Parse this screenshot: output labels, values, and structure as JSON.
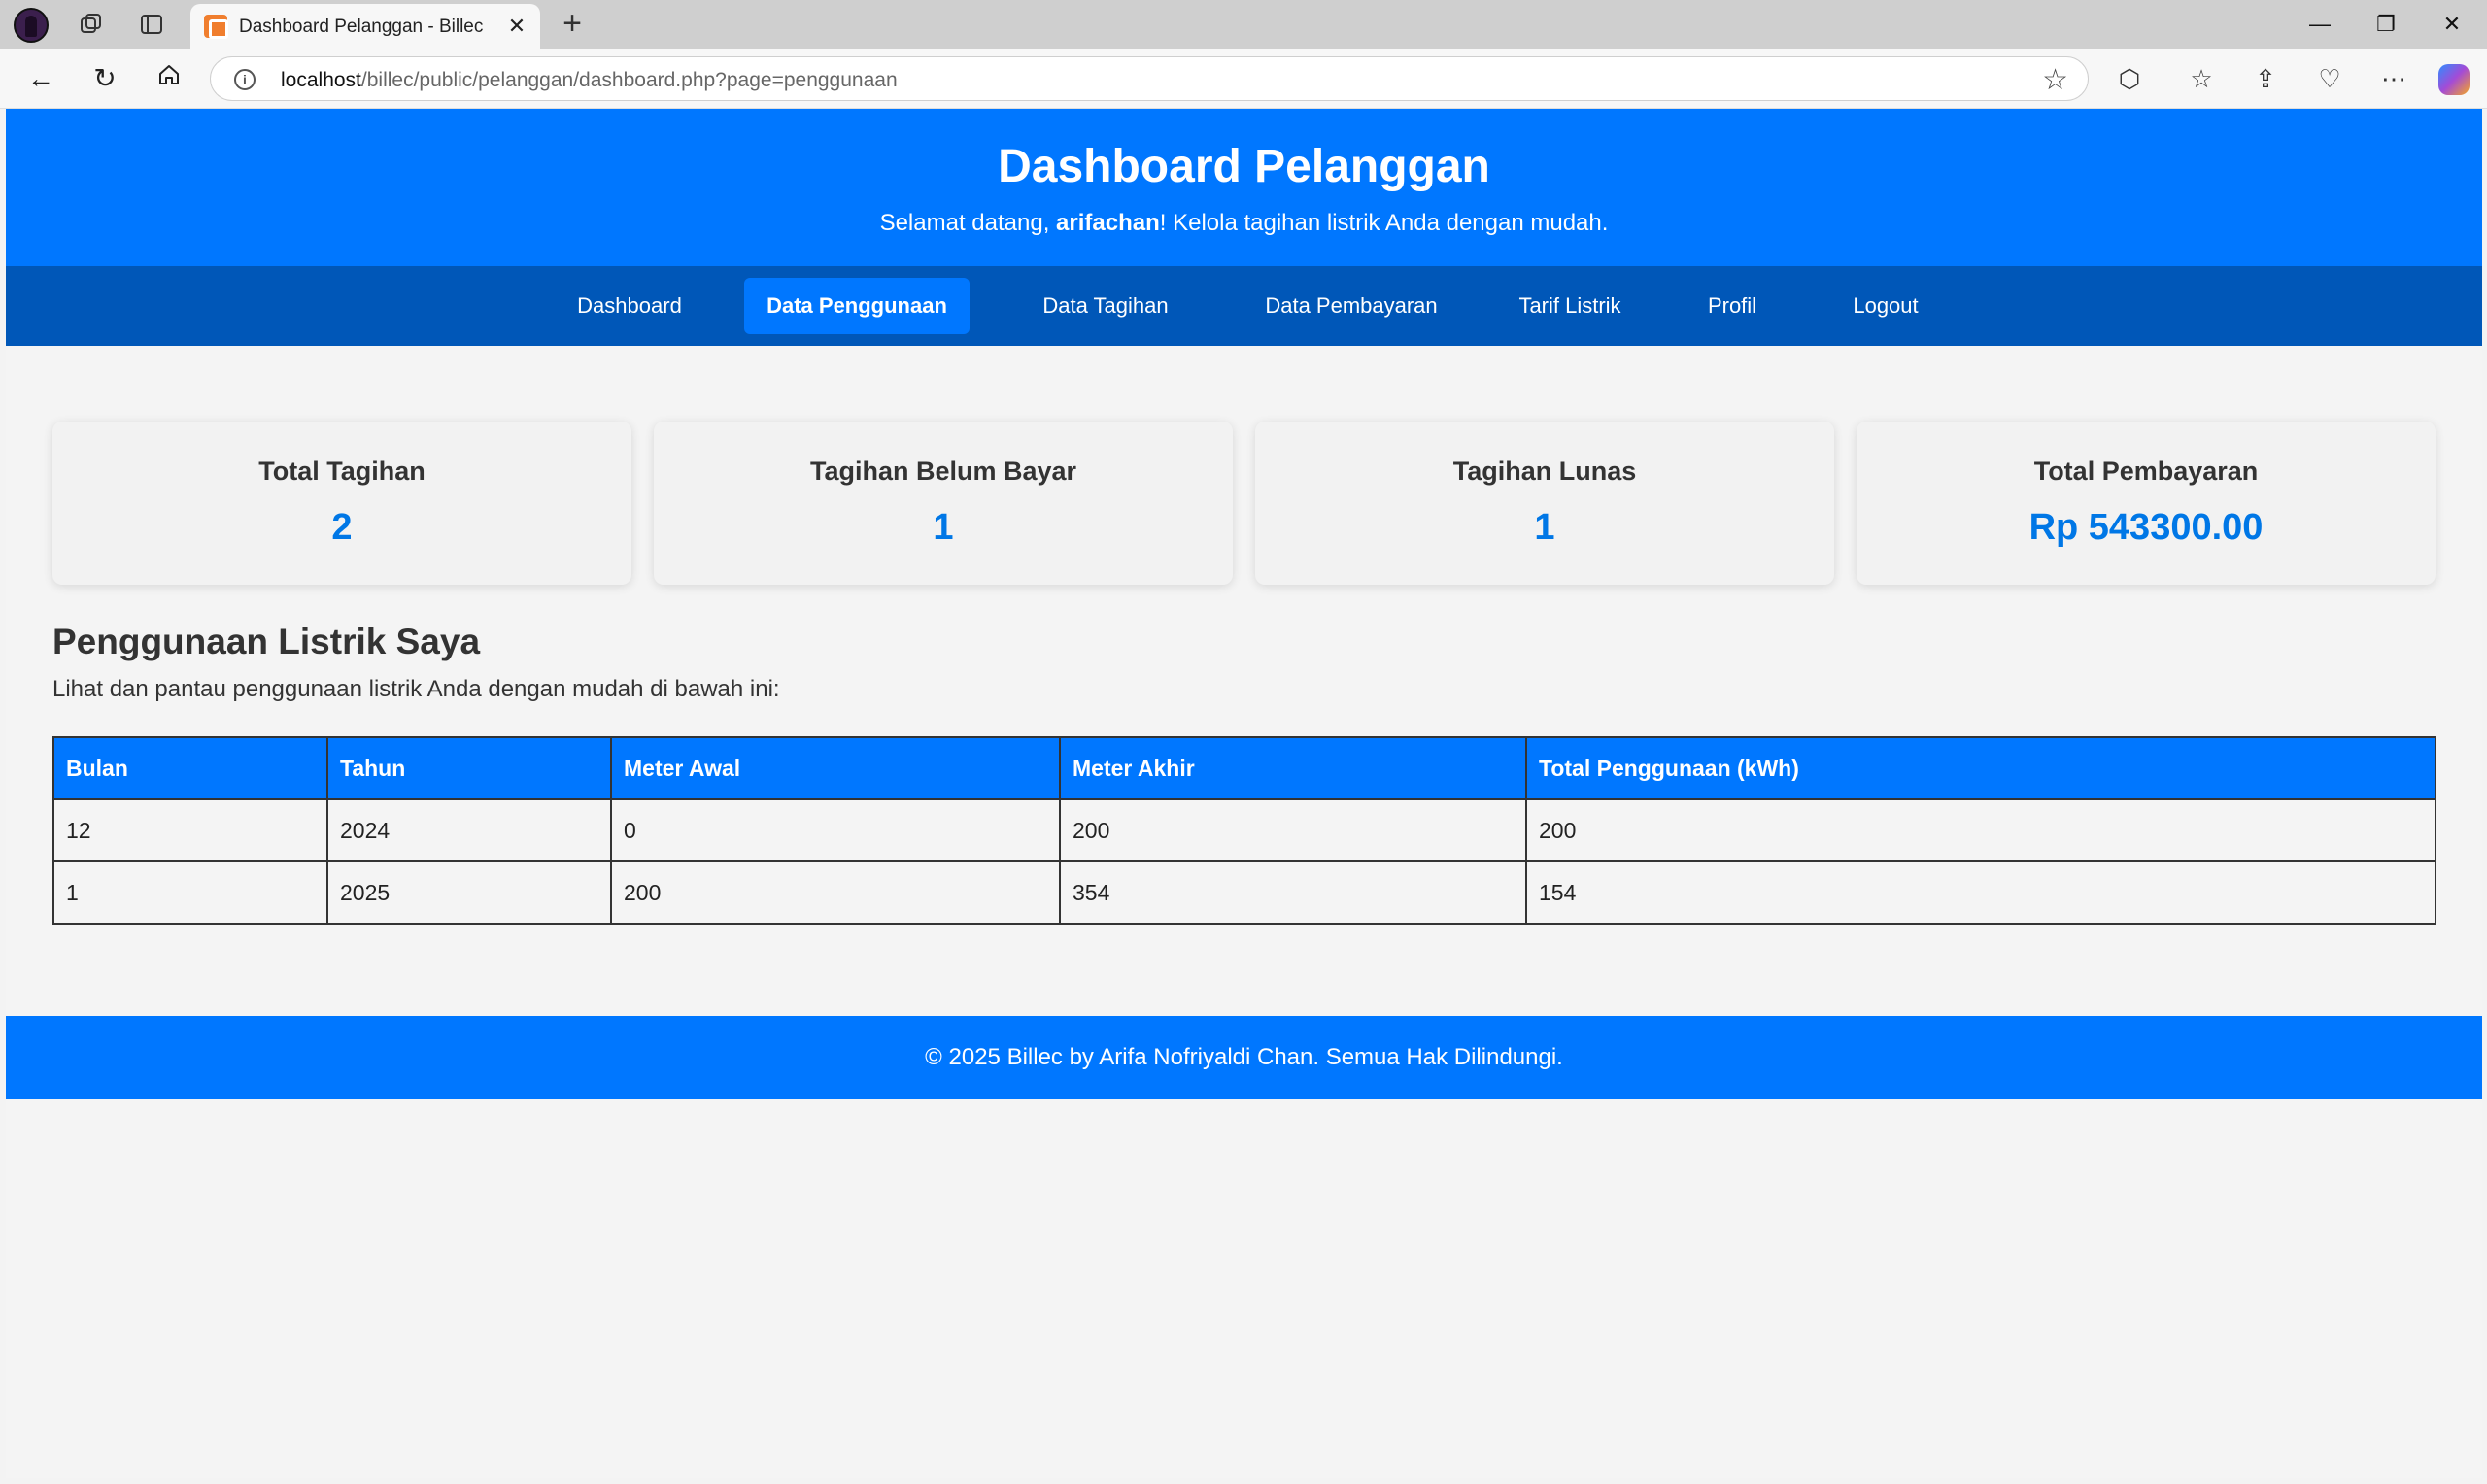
{
  "browser": {
    "tab_title": "Dashboard Pelanggan - Billec",
    "url_host": "localhost",
    "url_path": "/billec/public/pelanggan/dashboard.php?page=penggunaan"
  },
  "header": {
    "title": "Dashboard Pelanggan",
    "welcome_prefix": "Selamat datang, ",
    "username": "arifachan",
    "welcome_suffix": "! Kelola tagihan listrik Anda dengan mudah."
  },
  "nav": {
    "items": [
      {
        "label": "Dashboard"
      },
      {
        "label": "Data Penggunaan"
      },
      {
        "label": "Data Tagihan"
      },
      {
        "label": "Data Pembayaran"
      },
      {
        "label": "Tarif Listrik"
      },
      {
        "label": "Profil"
      },
      {
        "label": "Logout"
      }
    ]
  },
  "stats": [
    {
      "title": "Total Tagihan",
      "value": "2"
    },
    {
      "title": "Tagihan Belum Bayar",
      "value": "1"
    },
    {
      "title": "Tagihan Lunas",
      "value": "1"
    },
    {
      "title": "Total Pembayaran",
      "value": "Rp 543300.00"
    }
  ],
  "usage": {
    "title": "Penggunaan Listrik Saya",
    "description": "Lihat dan pantau penggunaan listrik Anda dengan mudah di bawah ini:",
    "columns": [
      "Bulan",
      "Tahun",
      "Meter Awal",
      "Meter Akhir",
      "Total Penggunaan (kWh)"
    ],
    "rows": [
      [
        "12",
        "2024",
        "0",
        "200",
        "200"
      ],
      [
        "1",
        "2025",
        "200",
        "354",
        "154"
      ]
    ]
  },
  "footer": {
    "text": "© 2025 Billec by Arifa Nofriyaldi Chan. Semua Hak Dilindungi."
  },
  "colors": {
    "primary": "#0077ff",
    "nav_bg": "#0057b8",
    "stat_value": "#0077e6"
  }
}
